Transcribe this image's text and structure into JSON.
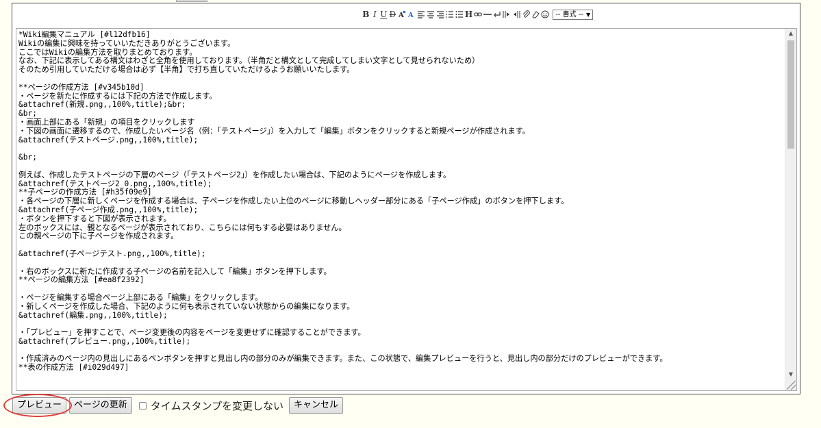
{
  "toolbar": {
    "bold": "B",
    "italic": "I",
    "underline": "U",
    "strike": "D",
    "heading": "H",
    "format_select": "-- 書式 --",
    "format_arrow": "▼"
  },
  "editor": {
    "text": "*Wiki編集マニュアル [#l12dfb16]\nWikiの編集に興味を持っていいただきありがとうございます。\nここではWikiの編集方法を取りまとめております。\nなお、下記に表示してある構文はわざと全角を使用しております。（半角だと構文として完成してしまい文字として見せられないため）\nそのため引用していただける場合は必ず【半角】で打ち直していただけるようお願いいたします。\n\n**ページの作成方法 [#v345b10d]\n・ページを新たに作成するには下記の方法で作成します。\n&attachref(新規.png,,100%,title);&br;\n&br;\n・画面上部にある「新規」の項目をクリックします\n・下図の画面に遷移するので、作成したいページ名（例：「テストページ」）を入力して「編集」ボタンをクリックすると新規ページが作成されます。\n&attachref(テストページ.png,,100%,title);\n\n&br;\n\n例えば、作成したテストページの下層のページ（「テストページ2」）を作成したい場合は、下記のようにページを作成します。\n&attachref(テストページ2_0.png,,100%,title);\n**子ページの作成方法 [#h35f09e9]\n・各ページの下層に新しくページを作成する場合は、子ページを作成したい上位のページに移動しヘッダー部分にある「子ページ作成」のボタンを押下します。\n&attachref(子ページ作成.png,,100%,title);\n・ボタンを押下すると下図が表示されます。\n左のボックスには、親となるページが表示されており、こちらには何もする必要はありません。\nこの親ページの下に子ページを作成されます。\n\n&attachref(子ページテスト.png,,100%,title);\n\n・右のボックスに新たに作成する子ページの名前を記入して「編集」ボタンを押下します。\n**ページの編集方法 [#ea8f2392]\n\n・ページを編集する場合ページ上部にある「編集」をクリックします。\n・新しくページを作成した場合、下記のように何も表示されていない状態からの編集になります。\n&attachref(編集.png,,100%,title);\n\n・「プレビュー」を押すことで、ページ変更後の内容をページを変更せずに確認することができます。\n&attachref(プレビュー.png,,100%,title);\n\n・作成済みのページ内の見出しにあるペンボタンを押すと見出し内の部分のみが編集できます。また、この状態で、編集プレビューを行うと、見出し内の部分だけのプレビューができます。\n**表の作成方法 [#i029d497]"
  },
  "actions": {
    "preview": "プレビュー",
    "update": "ページの更新",
    "keep_timestamp": "タイムスタンプを変更しない",
    "cancel": "キャンセル"
  },
  "colors": {
    "highlight": "#e23a3a",
    "page_bg": "#fffff4"
  }
}
